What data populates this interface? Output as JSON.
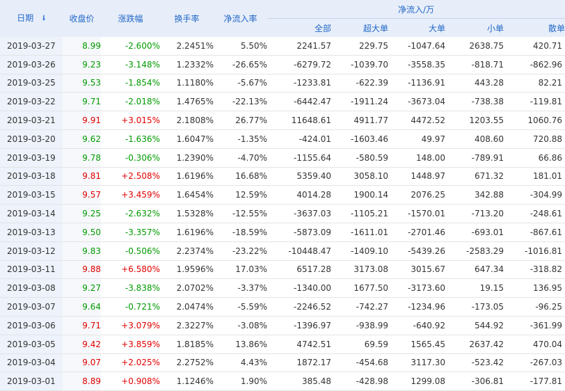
{
  "header": {
    "date": "日期",
    "close": "收盘价",
    "change": "涨跌幅",
    "turnover": "换手率",
    "net_rate": "净流入率",
    "net_flow_group": "净流入/万",
    "total": "全部",
    "super_large": "超大单",
    "large": "大单",
    "small": "小单",
    "retail": "散单",
    "sort_icon": "sort-down-arrow"
  },
  "colors": {
    "up": "#e00000",
    "down": "#009900",
    "header_bg": "#e7eef9",
    "header_text": "#2468c8"
  },
  "rows": [
    {
      "date": "2019-03-27",
      "close": "8.99",
      "change": "-2.600%",
      "dir": "down",
      "turnover": "2.2451%",
      "net_rate": "5.50%",
      "total": "2241.57",
      "super_large": "229.75",
      "large": "-1047.64",
      "small": "2638.75",
      "retail": "420.71"
    },
    {
      "date": "2019-03-26",
      "close": "9.23",
      "change": "-3.148%",
      "dir": "down",
      "turnover": "1.2332%",
      "net_rate": "-26.65%",
      "total": "-6279.72",
      "super_large": "-1039.70",
      "large": "-3558.35",
      "small": "-818.71",
      "retail": "-862.96"
    },
    {
      "date": "2019-03-25",
      "close": "9.53",
      "change": "-1.854%",
      "dir": "down",
      "turnover": "1.1180%",
      "net_rate": "-5.67%",
      "total": "-1233.81",
      "super_large": "-622.39",
      "large": "-1136.91",
      "small": "443.28",
      "retail": "82.21"
    },
    {
      "date": "2019-03-22",
      "close": "9.71",
      "change": "-2.018%",
      "dir": "down",
      "turnover": "1.4765%",
      "net_rate": "-22.13%",
      "total": "-6442.47",
      "super_large": "-1911.24",
      "large": "-3673.04",
      "small": "-738.38",
      "retail": "-119.81"
    },
    {
      "date": "2019-03-21",
      "close": "9.91",
      "change": "+3.015%",
      "dir": "up",
      "turnover": "2.1808%",
      "net_rate": "26.77%",
      "total": "11648.61",
      "super_large": "4911.77",
      "large": "4472.52",
      "small": "1203.55",
      "retail": "1060.76"
    },
    {
      "date": "2019-03-20",
      "close": "9.62",
      "change": "-1.636%",
      "dir": "down",
      "turnover": "1.6047%",
      "net_rate": "-1.35%",
      "total": "-424.01",
      "super_large": "-1603.46",
      "large": "49.97",
      "small": "408.60",
      "retail": "720.88"
    },
    {
      "date": "2019-03-19",
      "close": "9.78",
      "change": "-0.306%",
      "dir": "down",
      "turnover": "1.2390%",
      "net_rate": "-4.70%",
      "total": "-1155.64",
      "super_large": "-580.59",
      "large": "148.00",
      "small": "-789.91",
      "retail": "66.86"
    },
    {
      "date": "2019-03-18",
      "close": "9.81",
      "change": "+2.508%",
      "dir": "up",
      "turnover": "1.6196%",
      "net_rate": "16.68%",
      "total": "5359.40",
      "super_large": "3058.10",
      "large": "1448.97",
      "small": "671.32",
      "retail": "181.01"
    },
    {
      "date": "2019-03-15",
      "close": "9.57",
      "change": "+3.459%",
      "dir": "up",
      "turnover": "1.6454%",
      "net_rate": "12.59%",
      "total": "4014.28",
      "super_large": "1900.14",
      "large": "2076.25",
      "small": "342.88",
      "retail": "-304.99"
    },
    {
      "date": "2019-03-14",
      "close": "9.25",
      "change": "-2.632%",
      "dir": "down",
      "turnover": "1.5328%",
      "net_rate": "-12.55%",
      "total": "-3637.03",
      "super_large": "-1105.21",
      "large": "-1570.01",
      "small": "-713.20",
      "retail": "-248.61"
    },
    {
      "date": "2019-03-13",
      "close": "9.50",
      "change": "-3.357%",
      "dir": "down",
      "turnover": "1.6196%",
      "net_rate": "-18.59%",
      "total": "-5873.09",
      "super_large": "-1611.01",
      "large": "-2701.46",
      "small": "-693.01",
      "retail": "-867.61"
    },
    {
      "date": "2019-03-12",
      "close": "9.83",
      "change": "-0.506%",
      "dir": "down",
      "turnover": "2.2374%",
      "net_rate": "-23.22%",
      "total": "-10448.47",
      "super_large": "-1409.10",
      "large": "-5439.26",
      "small": "-2583.29",
      "retail": "-1016.81"
    },
    {
      "date": "2019-03-11",
      "close": "9.88",
      "change": "+6.580%",
      "dir": "up",
      "turnover": "1.9596%",
      "net_rate": "17.03%",
      "total": "6517.28",
      "super_large": "3173.08",
      "large": "3015.67",
      "small": "647.34",
      "retail": "-318.82"
    },
    {
      "date": "2019-03-08",
      "close": "9.27",
      "change": "-3.838%",
      "dir": "down",
      "turnover": "2.0702%",
      "net_rate": "-3.37%",
      "total": "-1340.00",
      "super_large": "1677.50",
      "large": "-3173.60",
      "small": "19.15",
      "retail": "136.95"
    },
    {
      "date": "2019-03-07",
      "close": "9.64",
      "change": "-0.721%",
      "dir": "down",
      "turnover": "2.0474%",
      "net_rate": "-5.59%",
      "total": "-2246.52",
      "super_large": "-742.27",
      "large": "-1234.96",
      "small": "-173.05",
      "retail": "-96.25"
    },
    {
      "date": "2019-03-06",
      "close": "9.71",
      "change": "+3.079%",
      "dir": "up",
      "turnover": "2.3227%",
      "net_rate": "-3.08%",
      "total": "-1396.97",
      "super_large": "-938.99",
      "large": "-640.92",
      "small": "544.92",
      "retail": "-361.99"
    },
    {
      "date": "2019-03-05",
      "close": "9.42",
      "change": "+3.859%",
      "dir": "up",
      "turnover": "1.8185%",
      "net_rate": "13.86%",
      "total": "4742.51",
      "super_large": "69.59",
      "large": "1565.45",
      "small": "2637.42",
      "retail": "470.04"
    },
    {
      "date": "2019-03-04",
      "close": "9.07",
      "change": "+2.025%",
      "dir": "up",
      "turnover": "2.2752%",
      "net_rate": "4.43%",
      "total": "1872.17",
      "super_large": "-454.68",
      "large": "3117.30",
      "small": "-523.42",
      "retail": "-267.03"
    },
    {
      "date": "2019-03-01",
      "close": "8.89",
      "change": "+0.908%",
      "dir": "up",
      "turnover": "1.1246%",
      "net_rate": "1.90%",
      "total": "385.48",
      "super_large": "-428.98",
      "large": "1299.08",
      "small": "-306.81",
      "retail": "-177.81"
    }
  ]
}
